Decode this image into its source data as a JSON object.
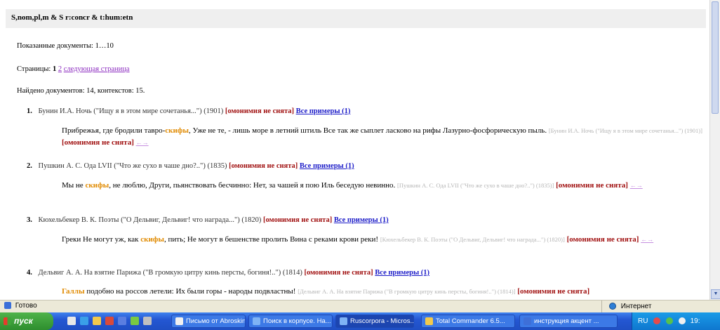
{
  "query": "S,nom,pl,m & S  r:concr & t:hum:etn",
  "summary": {
    "shown": "Показанные документы: 1…10",
    "pages_label": "Страницы:",
    "current_page": "1",
    "page_2": "2",
    "next_page": "следующая страница",
    "found": "Найдено документов: 14, контекстов: 15."
  },
  "results": [
    {
      "num": "1.",
      "title": "Бунин И.А. Ночь (\"Ищу я в этом мире сочетанья...\") (1901)",
      "homonymy": "[омонимия не снята]",
      "all_examples": "Все примеры (1)",
      "text_before": "Прибрежья, где бродили тавро-",
      "hit": "скифы",
      "text_after": ", Уже не те, - лишь море в летний штиль Все так же сыплет ласково на рифы Лазурно-фосфорическую пыль.",
      "source": "[Бунин И.А. Ночь (\"Ищу я в этом мире сочетанья...\") (1901)]",
      "homonymy2": "[омонимия не снята]",
      "arrows": "←→"
    },
    {
      "num": "2.",
      "title": "Пушкин А. С. Ода LVII (\"Что же сухо в чаше дно?..\") (1835)",
      "homonymy": "[омонимия не снята]",
      "all_examples": "Все примеры (1)",
      "text_before": "Мы не ",
      "hit": "скифы",
      "text_after": ", не люблю, Други, пьянствовать бесчинно: Нет, за чашей я пою Иль беседую невинно.",
      "source": "[Пушкин А. С. Ода LVII (\"Что же сухо в чаше дно?..\") (1835)]",
      "homonymy2": "[омонимия не снята]",
      "arrows": "←→"
    },
    {
      "num": "3.",
      "title": "Кюхельбекер В. К. Поэты (\"О Дельвиг, Дельвиг! что награда...\") (1820)",
      "homonymy": "[омонимия не снята]",
      "all_examples": "Все примеры (1)",
      "text_before": "Греки Не могут уж, как ",
      "hit": "скифы",
      "text_after": ", пить; Не могут в бешенстве пролить Вина с реками крови реки!",
      "source": "[Кюхельбекер В. К. Поэты (\"О Дельвиг, Дельвиг! что награда...\") (1820)]",
      "homonymy2": "[омонимия не снята]",
      "arrows": "←→"
    },
    {
      "num": "4.",
      "title": "Дельвиг А. А. На взятие Парижа (\"В громкую цитру кинь персты, богиня!..\") (1814)",
      "homonymy": "[омонимия не снята]",
      "all_examples": "Все примеры (1)",
      "text_before": "",
      "hit": "Галлы",
      "text_after": " подобно на россов летели: Их были горы - народы подвластны!",
      "source": "[Дельвиг А. А. На взятие Парижа (\"В громкую цитру кинь персты, богиня!..\") (1814)]",
      "homonymy2": "[омонимия не снята]",
      "arrows": ""
    }
  ],
  "statusbar": {
    "left": "Готово",
    "right": "Интернет"
  },
  "taskbar": {
    "start": "пуск",
    "tasks": [
      "Письмо от Abroskin ...",
      "Поиск в корпусе. На...",
      "Ruscorpora - Micros...",
      "Total Commander 6.5...",
      "инструкция акцент ..."
    ],
    "tray_lang": "RU",
    "tray_time": "19:"
  },
  "colors": {
    "hit": "#e08a00",
    "homonymy": "#a01010",
    "link": "#1c1cc8",
    "visited": "#8b2bbf",
    "taskbar": "#2457d3"
  }
}
